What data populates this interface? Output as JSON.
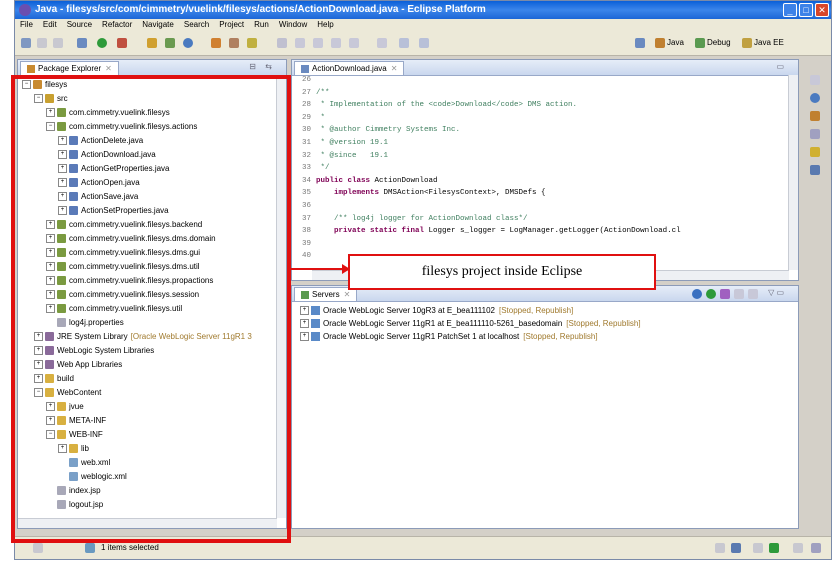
{
  "window": {
    "title": "Java - filesys/src/com/cimmetry/vuelink/filesys/actions/ActionDownload.java - Eclipse Platform"
  },
  "menu": [
    "File",
    "Edit",
    "Source",
    "Refactor",
    "Navigate",
    "Search",
    "Project",
    "Run",
    "Window",
    "Help"
  ],
  "perspectives": [
    "Java",
    "Debug",
    "Java EE"
  ],
  "package_explorer": {
    "tab": "Package Explorer",
    "items": [
      {
        "label": "filesys",
        "depth": 0,
        "toggle": "-",
        "icon": "project-icon"
      },
      {
        "label": "src",
        "depth": 1,
        "toggle": "-",
        "icon": "source-folder-icon"
      },
      {
        "label": "com.cimmetry.vuelink.filesys",
        "depth": 2,
        "toggle": "+",
        "icon": "package-icon"
      },
      {
        "label": "com.cimmetry.vuelink.filesys.actions",
        "depth": 2,
        "toggle": "-",
        "icon": "package-icon"
      },
      {
        "label": "ActionDelete.java",
        "depth": 3,
        "toggle": "+",
        "icon": "java-file-icon"
      },
      {
        "label": "ActionDownload.java",
        "depth": 3,
        "toggle": "+",
        "icon": "java-file-icon"
      },
      {
        "label": "ActionGetProperties.java",
        "depth": 3,
        "toggle": "+",
        "icon": "java-file-icon"
      },
      {
        "label": "ActionOpen.java",
        "depth": 3,
        "toggle": "+",
        "icon": "java-file-icon"
      },
      {
        "label": "ActionSave.java",
        "depth": 3,
        "toggle": "+",
        "icon": "java-file-icon"
      },
      {
        "label": "ActionSetProperties.java",
        "depth": 3,
        "toggle": "+",
        "icon": "java-file-icon"
      },
      {
        "label": "com.cimmetry.vuelink.filesys.backend",
        "depth": 2,
        "toggle": "+",
        "icon": "package-icon"
      },
      {
        "label": "com.cimmetry.vuelink.filesys.dms.domain",
        "depth": 2,
        "toggle": "+",
        "icon": "package-icon"
      },
      {
        "label": "com.cimmetry.vuelink.filesys.dms.gui",
        "depth": 2,
        "toggle": "+",
        "icon": "package-icon"
      },
      {
        "label": "com.cimmetry.vuelink.filesys.dms.util",
        "depth": 2,
        "toggle": "+",
        "icon": "package-icon"
      },
      {
        "label": "com.cimmetry.vuelink.filesys.propactions",
        "depth": 2,
        "toggle": "+",
        "icon": "package-icon"
      },
      {
        "label": "com.cimmetry.vuelink.filesys.session",
        "depth": 2,
        "toggle": "+",
        "icon": "package-icon"
      },
      {
        "label": "com.cimmetry.vuelink.filesys.util",
        "depth": 2,
        "toggle": "+",
        "icon": "package-icon"
      },
      {
        "label": "log4j.properties",
        "depth": 2,
        "toggle": "",
        "icon": "file-icon"
      },
      {
        "label": "JRE System Library",
        "deco": "[Oracle WebLogic Server 11gR1 3",
        "depth": 1,
        "toggle": "+",
        "icon": "library-icon"
      },
      {
        "label": "WebLogic System Libraries",
        "depth": 1,
        "toggle": "+",
        "icon": "library-icon"
      },
      {
        "label": "Web App Libraries",
        "depth": 1,
        "toggle": "+",
        "icon": "library-icon"
      },
      {
        "label": "build",
        "depth": 1,
        "toggle": "+",
        "icon": "folder-icon"
      },
      {
        "label": "WebContent",
        "depth": 1,
        "toggle": "-",
        "icon": "folder-icon"
      },
      {
        "label": "jvue",
        "depth": 2,
        "toggle": "+",
        "icon": "folder-icon"
      },
      {
        "label": "META-INF",
        "depth": 2,
        "toggle": "+",
        "icon": "folder-icon"
      },
      {
        "label": "WEB-INF",
        "depth": 2,
        "toggle": "-",
        "icon": "folder-icon"
      },
      {
        "label": "lib",
        "depth": 3,
        "toggle": "+",
        "icon": "folder-icon"
      },
      {
        "label": "web.xml",
        "depth": 3,
        "toggle": "",
        "icon": "xml-file-icon"
      },
      {
        "label": "weblogic.xml",
        "depth": 3,
        "toggle": "",
        "icon": "xml-file-icon"
      },
      {
        "label": "index.jsp",
        "depth": 2,
        "toggle": "",
        "icon": "file-icon"
      },
      {
        "label": "logout.jsp",
        "depth": 2,
        "toggle": "",
        "icon": "file-icon"
      }
    ]
  },
  "editor": {
    "tab": "ActionDownload.java",
    "lines": [
      {
        "n": "26",
        "segs": []
      },
      {
        "n": "27",
        "segs": [
          {
            "c": "cmt",
            "t": "/**"
          }
        ]
      },
      {
        "n": "28",
        "segs": [
          {
            "c": "cmt",
            "t": " * Implementation of the <code>Download</code> DMS action."
          }
        ]
      },
      {
        "n": "29",
        "segs": [
          {
            "c": "cmt",
            "t": " *"
          }
        ]
      },
      {
        "n": "30",
        "segs": [
          {
            "c": "cmt",
            "t": " * @author Cimmetry Systems Inc."
          }
        ]
      },
      {
        "n": "31",
        "segs": [
          {
            "c": "cmt",
            "t": " * @version 19.1"
          }
        ]
      },
      {
        "n": "32",
        "segs": [
          {
            "c": "cmt",
            "t": " * @since   19.1"
          }
        ]
      },
      {
        "n": "33",
        "segs": [
          {
            "c": "cmt",
            "t": " */"
          }
        ]
      },
      {
        "n": "34",
        "segs": [
          {
            "c": "kw",
            "t": "public class "
          },
          {
            "c": "",
            "t": "ActionDownload"
          }
        ]
      },
      {
        "n": "35",
        "segs": [
          {
            "c": "kw",
            "t": "    implements "
          },
          {
            "c": "",
            "t": "DMSAction<FilesysContext>, DMSDefs {"
          }
        ]
      },
      {
        "n": "36",
        "segs": []
      },
      {
        "n": "37",
        "segs": [
          {
            "c": "cmt",
            "t": "    /** log4j logger for ActionDownload class*/"
          }
        ]
      },
      {
        "n": "38",
        "segs": [
          {
            "c": "kw",
            "t": "    private static final "
          },
          {
            "c": "",
            "t": "Logger s_logger = LogManager.getLogger(ActionDownload.cl"
          }
        ]
      },
      {
        "n": "39",
        "segs": []
      },
      {
        "n": "40",
        "segs": []
      }
    ]
  },
  "servers": {
    "tab": "Servers",
    "items": [
      {
        "name": "Oracle WebLogic Server 10gR3 at E_bea111102",
        "state": "[Stopped, Republish]"
      },
      {
        "name": "Oracle WebLogic Server 11gR1 at E_bea111110-5261_basedomain",
        "state": "[Stopped, Republish]"
      },
      {
        "name": "Oracle WebLogic Server 11gR1 PatchSet 1 at localhost",
        "state": "[Stopped, Republish]"
      }
    ]
  },
  "status": {
    "selected": "1 items selected"
  },
  "callout": {
    "text": "filesys project inside Eclipse"
  },
  "colors": {
    "annotation_red": "#e01010",
    "titlebar_blue": "#0a5fd8"
  }
}
